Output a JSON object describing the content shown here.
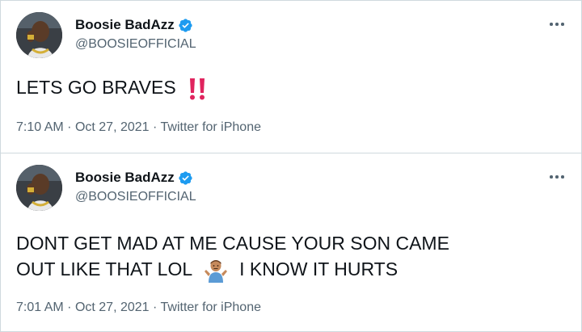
{
  "tweets": [
    {
      "display_name": "Boosie BadAzz",
      "handle": "@BOOSIEOFFICIAL",
      "verified_icon": "verified-badge-icon",
      "text_before": "LETS GO BRAVES",
      "emoji": "double-exclamation-icon",
      "time": "7:10 AM",
      "date": "Oct 27, 2021",
      "source": "Twitter for iPhone",
      "sep": "·"
    },
    {
      "display_name": "Boosie BadAzz",
      "handle": "@BOOSIEOFFICIAL",
      "verified_icon": "verified-badge-icon",
      "line1": "DONT GET MAD AT ME CAUSE YOUR SON CAME",
      "line2_before": "OUT LIKE THAT LOL",
      "emoji": "man-shrugging-icon",
      "line2_after": "I KNOW IT HURTS",
      "time": "7:01 AM",
      "date": "Oct 27, 2021",
      "source": "Twitter for iPhone",
      "sep": "·"
    }
  ],
  "colors": {
    "text": "#0f1419",
    "secondary": "#536471",
    "verified": "#1d9bf0",
    "border": "#cfd9de",
    "exclamation": "#e0245e"
  }
}
